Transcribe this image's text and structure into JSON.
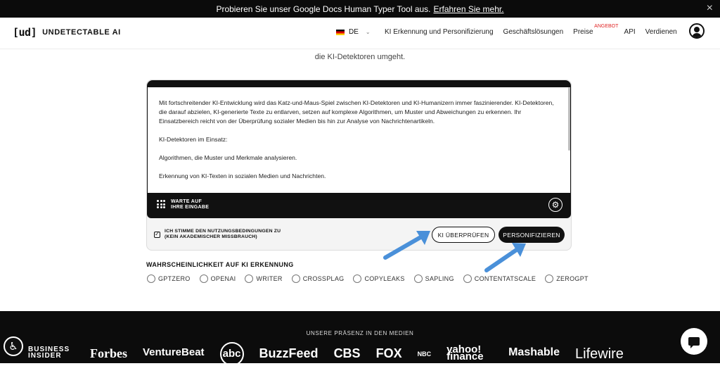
{
  "announcement": {
    "text": "Probieren Sie unser Google Docs Human Typer Tool aus.",
    "link": "Erfahren Sie mehr.",
    "close_icon": "×"
  },
  "header": {
    "logo_mark": "[ud]",
    "logo_text": "UNDETECTABLE AI",
    "language": "DE",
    "nav": [
      "KI Erkennung und Personifizierung",
      "Geschäftslösungen",
      "Preise",
      "API",
      "Verdienen"
    ],
    "offer_badge": "ANGEBOT"
  },
  "subtitle": "die KI-Detektoren umgeht.",
  "editor": {
    "paragraphs": [
      "Mit fortschreitender KI-Entwicklung wird das Katz-und-Maus-Spiel zwischen KI-Detektoren und KI-Humanizern immer faszinierender. KI-Detektoren, die darauf abzielen, KI-generierte Texte zu entlarven, setzen auf komplexe Algorithmen, um Muster und Abweichungen zu erkennen. Ihr Einsatzbereich reicht von der Überprüfung sozialer Medien bis hin zur Analyse von Nachrichtenartikeln.",
      "KI-Detektoren im Einsatz:",
      "Algorithmen, die Muster und Merkmale analysieren.",
      "Erkennung von KI-Texten in sozialen Medien und Nachrichten."
    ],
    "status_line1": "WARTE AUF",
    "status_line2": "IHRE EINGABE"
  },
  "terms": {
    "line1": "ICH STIMME DEN NUTZUNGSBEDINGUNGEN ZU",
    "line2": "(KEIN AKADEMISCHER MISSBRAUCH)"
  },
  "buttons": {
    "check": "KI ÜBERPRÜFEN",
    "humanize": "PERSONIFIZIEREN"
  },
  "detectors": {
    "title": "WAHRSCHEINLICHKEIT AUF KI ERKENNUNG",
    "items": [
      "GPTZERO",
      "OPENAI",
      "WRITER",
      "CROSSPLAG",
      "COPYLEAKS",
      "SAPLING",
      "CONTENTATSCALE",
      "ZEROGPT"
    ]
  },
  "media": {
    "title": "UNSERE PRÄSENZ IN DEN MEDIEN",
    "logos": [
      "BUSINESS INSIDER",
      "Forbes",
      "VentureBeat",
      "abc",
      "BuzzFeed",
      "CBS",
      "FOX",
      "NBC",
      "yahoo! finance",
      "Mashable",
      "Lifewire"
    ]
  },
  "colors": {
    "accent_arrow": "#4a90d9",
    "dark": "#111111",
    "badge_red": "#e02424"
  }
}
